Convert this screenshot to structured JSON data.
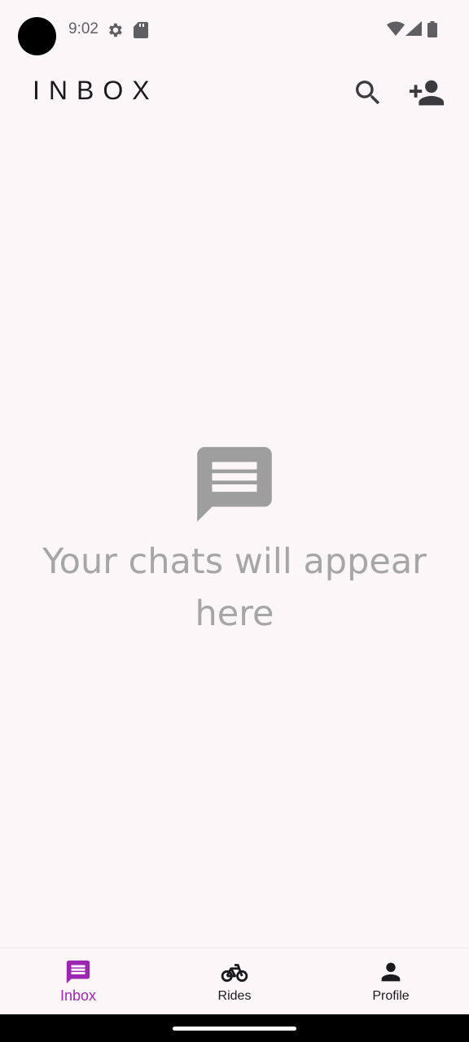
{
  "status_bar": {
    "time": "9:02",
    "icons": [
      "gear-icon",
      "sd-card-icon",
      "wifi-icon",
      "signal-icon",
      "battery-icon"
    ]
  },
  "app_bar": {
    "title": "INBOX",
    "actions": [
      "search-icon",
      "add-person-icon"
    ]
  },
  "empty_state": {
    "icon": "chat-icon",
    "message": "Your chats will appear here"
  },
  "bottom_nav": {
    "items": [
      {
        "label": "Inbox",
        "icon": "chat-icon",
        "active": true
      },
      {
        "label": "Rides",
        "icon": "bike-icon",
        "active": false
      },
      {
        "label": "Profile",
        "icon": "person-icon",
        "active": false
      }
    ]
  },
  "colors": {
    "background": "#fdf6f9",
    "accent": "#9c27b0",
    "muted_text": "#a6a6a6",
    "empty_icon": "#9e9e9e"
  }
}
